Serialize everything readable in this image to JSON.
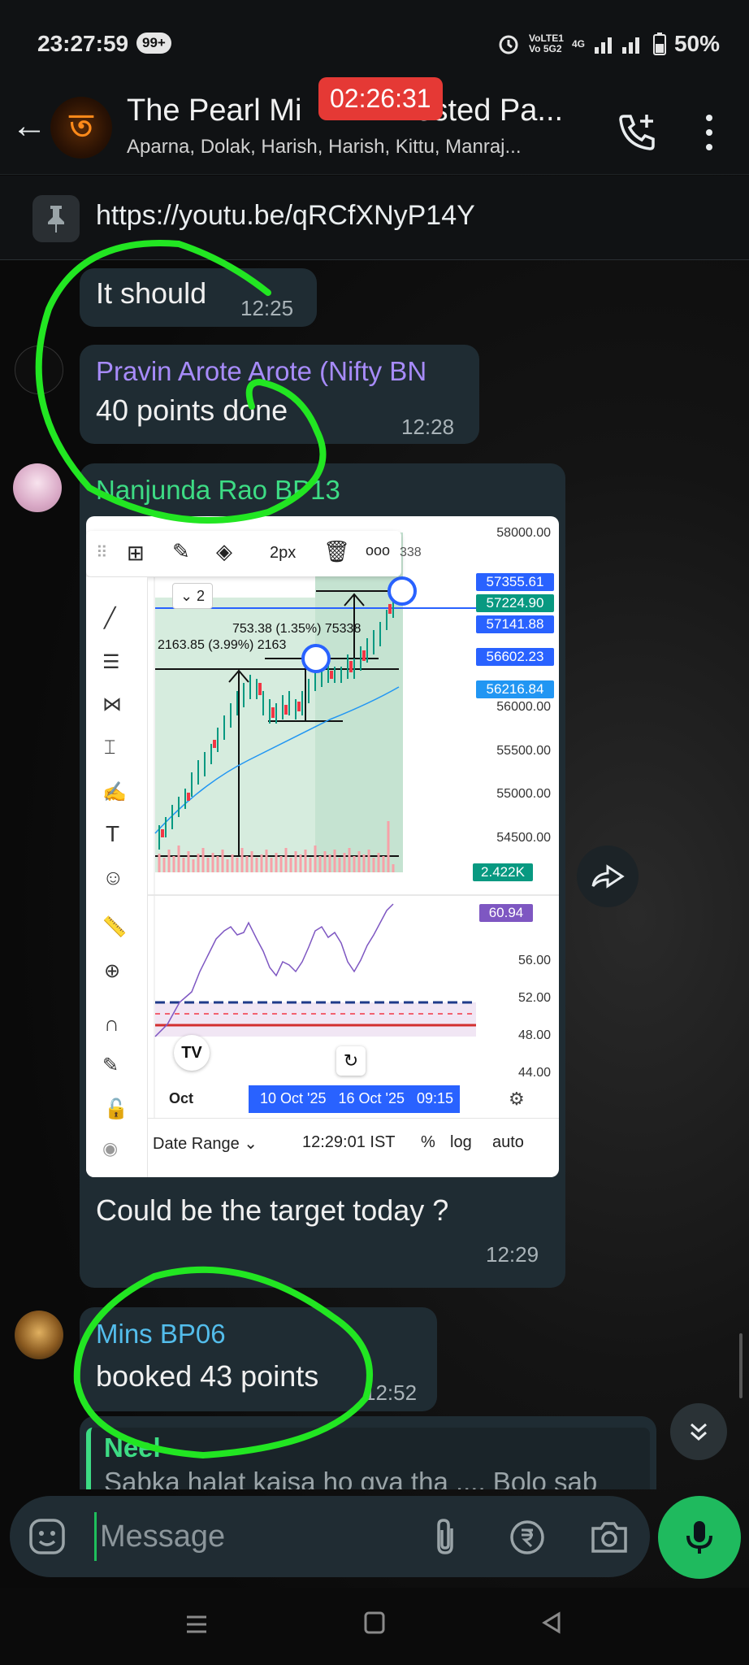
{
  "status_bar": {
    "time": "23:27:59",
    "badge": "99+",
    "network_top": "VoLTE1",
    "network_bottom": "Vo 5G2",
    "net_type": "4G",
    "battery": "50%"
  },
  "header": {
    "title": "The Pearl Mi",
    "title_tail": "ested Pa...",
    "members": "Aparna, Dolak, Harish, Harish, Kittu, Manraj...",
    "call_timer": "02:26:31",
    "avatar_glyph": "ত"
  },
  "pinned": {
    "text": "https://youtu.be/qRCfXNyP14Y"
  },
  "messages": [
    {
      "text": "It should",
      "time": "12:25"
    },
    {
      "sender": "Pravin Arote Arote (Nifty BN",
      "sender_color": "#a78bfa",
      "text": "40 points done",
      "time": "12:28"
    },
    {
      "sender": "Nanjunda Rao BP13",
      "sender_color": "#3ddc84",
      "caption": "Could be the target today  ?",
      "time": "12:29"
    },
    {
      "sender": "Mins BP06",
      "sender_color": "#53bdeb",
      "text": "booked 43 points",
      "time": "12:52"
    },
    {
      "quote_sender": "Neel",
      "quote_text": "Sabka halat kaisa ho gya tha .... Bolo sab"
    }
  ],
  "chart": {
    "toolbar": {
      "width_label": "2px",
      "more": "ooo"
    },
    "layout_badge": "2",
    "price_axis": [
      "58000.00",
      "56000.00",
      "55500.00",
      "55000.00",
      "54500.00"
    ],
    "price_tags": [
      {
        "label": "57355.61",
        "color": "#2962ff"
      },
      {
        "label": "57224.90",
        "color": "#089981"
      },
      {
        "label": "57141.88",
        "color": "#2962ff"
      },
      {
        "label": "56602.23",
        "color": "#2962ff"
      },
      {
        "label": "56216.84",
        "color": "#2196f3"
      }
    ],
    "volume_tag": "2.422K",
    "rsi_tag": "60.94",
    "rsi_axis": [
      "56.00",
      "52.00",
      "48.00",
      "44.00"
    ],
    "measure_label_1": "753.38 (1.35%) 75338",
    "measure_label_2": "2163.85 (3.99%) 2163",
    "measure_partial": "338",
    "x_axis_start": "Oct",
    "date_range_highlight": "10 Oct '25   16 Oct '25   09:15",
    "bottom": {
      "date_range": "Date Range",
      "clock": "12:29:01 IST",
      "percent": "%",
      "log": "log",
      "auto": "auto"
    }
  },
  "input": {
    "placeholder": "Message"
  },
  "colors": {
    "accent_green": "#1fba5e",
    "bubble": "#1f2c33",
    "timer_red": "#e53935"
  }
}
